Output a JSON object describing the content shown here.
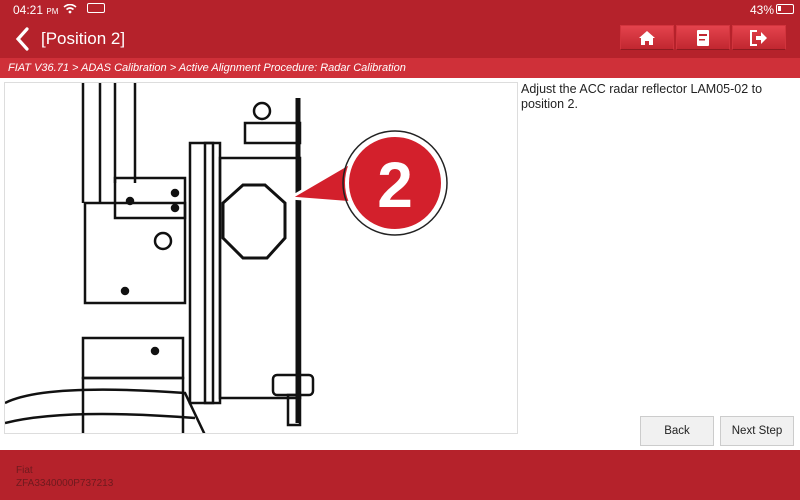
{
  "status_bar": {
    "time": "04:21",
    "ampm": "PM",
    "battery": "43%",
    "battery_level": 0.43,
    "icons": [
      "wifi-icon",
      "vci-icon",
      "battery-icon"
    ]
  },
  "header": {
    "title": "[Position 2]",
    "buttons": [
      {
        "icon": "home-icon"
      },
      {
        "icon": "adas-report-icon"
      },
      {
        "icon": "exit-icon"
      }
    ]
  },
  "breadcrumb": "FIAT V36.71 > ADAS Calibration > Active Alignment Procedure: Radar Calibration",
  "main": {
    "callout_number": "2",
    "instruction": "Adjust the ACC radar reflector LAM05-02 to position 2."
  },
  "actions": {
    "back": "Back",
    "next": "Next Step"
  },
  "footer": {
    "make": "Fiat",
    "vin": "ZFA3340000P737213"
  },
  "colors": {
    "primary": "#b5222b",
    "breadcrumb": "#cf3039"
  }
}
